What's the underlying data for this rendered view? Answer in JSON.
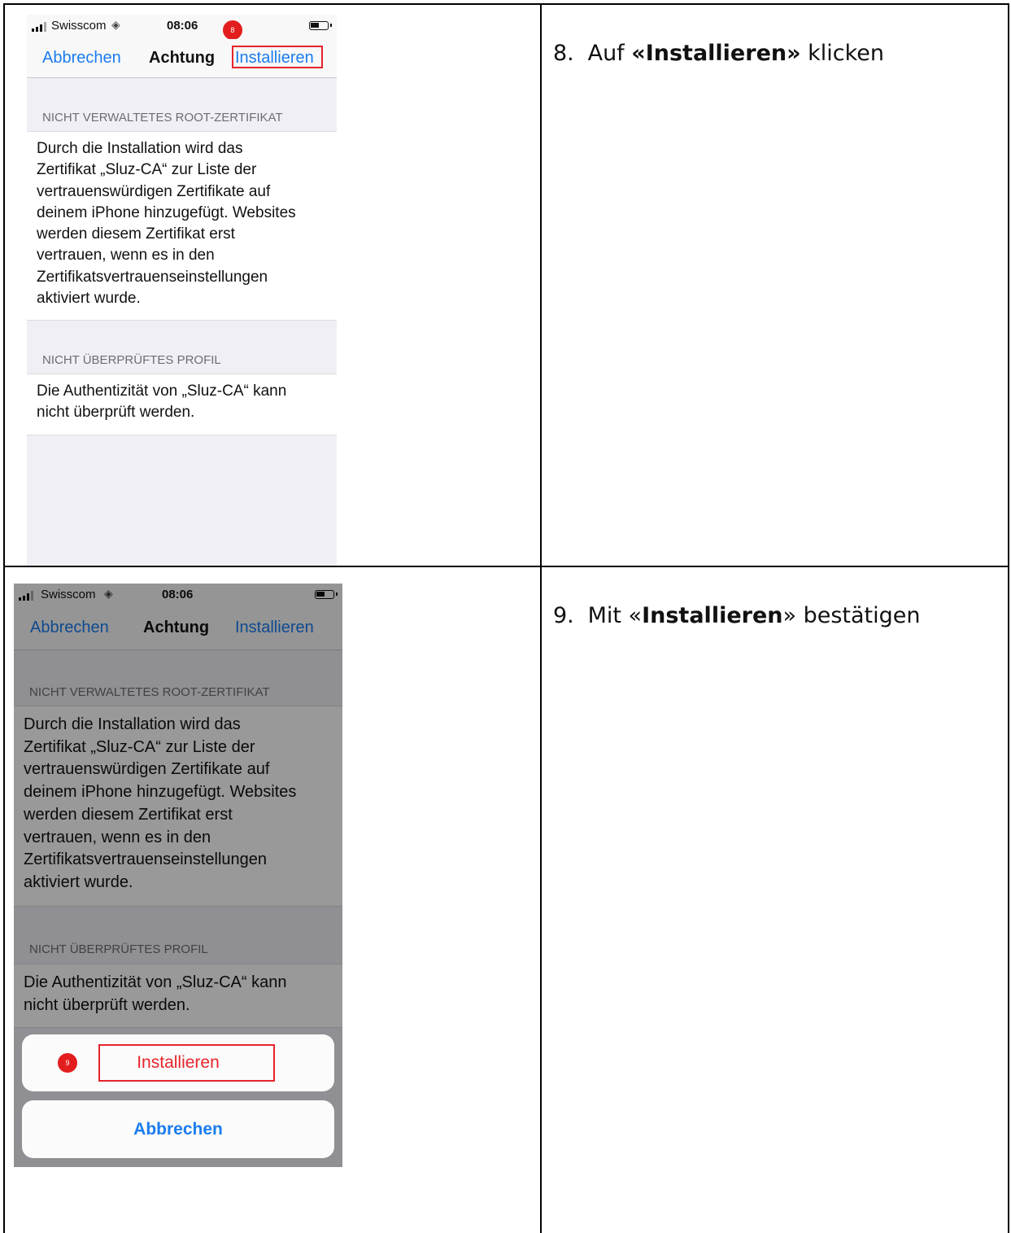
{
  "steps": [
    {
      "number": "8.",
      "prefix": "Auf ",
      "bold": "«Installieren»",
      "suffix": " klicken"
    },
    {
      "number": "9.",
      "prefix": "Mit «",
      "bold": "Installieren",
      "suffix": "» bestätigen"
    }
  ],
  "screenshots": [
    {
      "status": {
        "carrier": "Swisscom",
        "time": "08:06",
        "wifi_icon": "wifi-icon",
        "battery_icon": "battery-icon"
      },
      "nav": {
        "cancel": "Abbrechen",
        "title": "Achtung",
        "install": "Installieren"
      },
      "badge": "8",
      "sections": [
        {
          "header": "NICHT VERWALTETES ROOT-ZERTIFIKAT",
          "lines": [
            "Durch die Installation wird das",
            "Zertifikat „Sluz-CA“ zur Liste der",
            "vertrauenswürdigen Zertifikate auf",
            "deinem iPhone hinzugefügt. Websites",
            "werden diesem Zertifikat erst",
            "vertrauen, wenn es in den",
            "Zertifikatsvertrauenseinstellungen",
            "aktiviert wurde."
          ]
        },
        {
          "header": "NICHT ÜBERPRÜFTES PROFIL",
          "lines": [
            "Die Authentizität von „Sluz-CA“ kann",
            "nicht überprüft werden."
          ]
        }
      ]
    },
    {
      "status": {
        "carrier": "Swisscom",
        "time": "08:06",
        "wifi_icon": "wifi-icon",
        "battery_icon": "battery-icon"
      },
      "nav": {
        "cancel": "Abbrechen",
        "title": "Achtung",
        "install": "Installieren"
      },
      "badge": "9",
      "sections": [
        {
          "header": "NICHT VERWALTETES ROOT-ZERTIFIKAT",
          "lines": [
            "Durch die Installation wird das",
            "Zertifikat „Sluz-CA“ zur Liste der",
            "vertrauenswürdigen Zertifikate auf",
            "deinem iPhone hinzugefügt. Websites",
            "werden diesem Zertifikat erst",
            "vertrauen, wenn es in den",
            "Zertifikatsvertrauenseinstellungen",
            "aktiviert wurde."
          ]
        },
        {
          "header": "NICHT ÜBERPRÜFTES PROFIL",
          "lines": [
            "Die Authentizität von „Sluz-CA“ kann",
            "nicht überprüft werden."
          ]
        }
      ],
      "action_sheet": {
        "install": "Installieren",
        "cancel": "Abbrechen"
      }
    }
  ],
  "colors": {
    "ios_blue": "#1a7cf0",
    "destructive_red": "#e5242b",
    "annotation_red": "#e31d1d",
    "grouped_background": "#f0eff5"
  }
}
